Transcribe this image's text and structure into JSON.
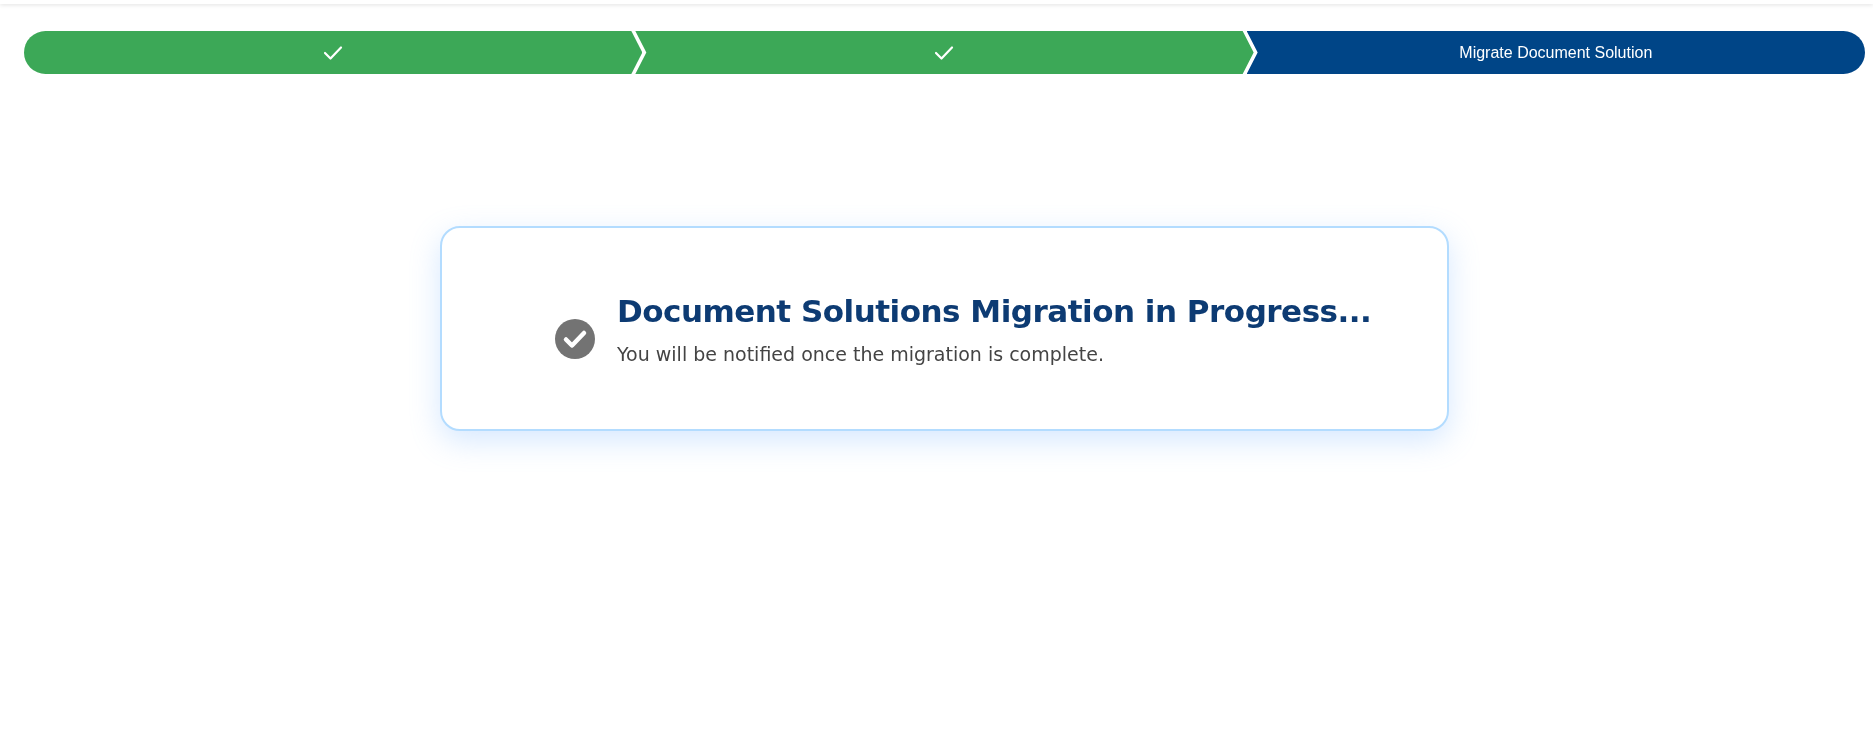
{
  "steps": [
    {
      "completed": true,
      "selected": false
    },
    {
      "completed": true,
      "selected": false
    },
    {
      "label": "Migrate Document Solution",
      "completed": false,
      "selected": true
    }
  ],
  "status_card": {
    "title": "Document Solutions Migration in Progress...",
    "message": "You will be notified once the migration is complete."
  }
}
